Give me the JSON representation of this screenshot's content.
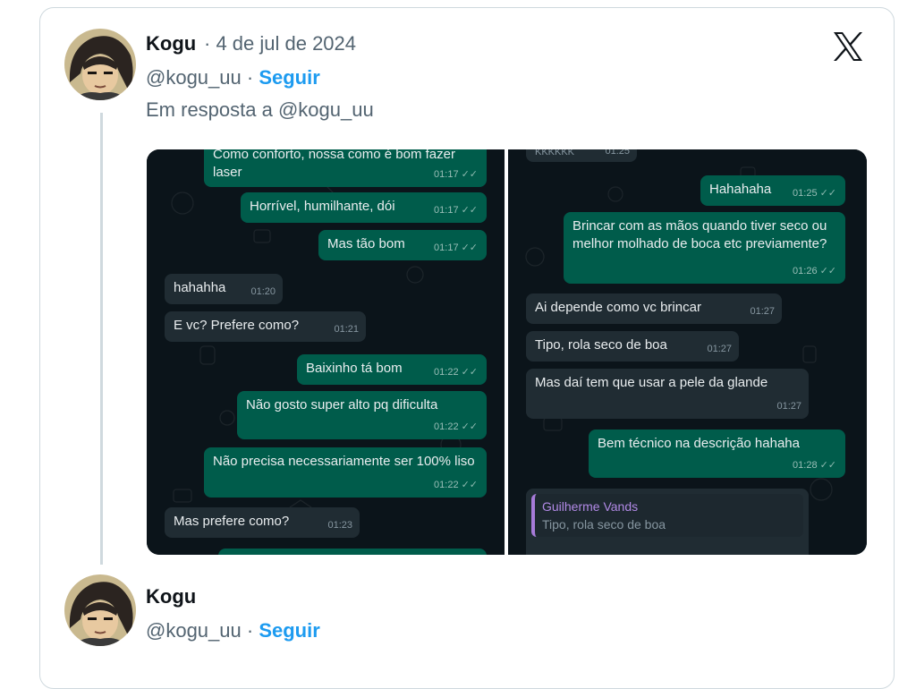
{
  "tweet1": {
    "author": "Kogu",
    "date": "· 4 de jul de 2024",
    "handle": "@kogu_uu ·",
    "follow": "Seguir",
    "reply_to": "Em resposta a @kogu_uu"
  },
  "tweet2": {
    "author": "Kogu",
    "handle": "@kogu_uu ·",
    "follow": "Seguir"
  },
  "logo": "x-logo-icon",
  "chat_left": [
    {
      "text": "Como conforto, nossa como é bom fazer laser",
      "time": "01:17",
      "dir": "out"
    },
    {
      "text": "Horrível, humilhante, dói",
      "time": "01:17",
      "dir": "out"
    },
    {
      "text": "Mas tão bom",
      "time": "01:17",
      "dir": "out"
    },
    {
      "text": "hahahha",
      "time": "01:20",
      "dir": "in"
    },
    {
      "text": "E vc? Prefere como?",
      "time": "01:21",
      "dir": "in"
    },
    {
      "text": "Baixinho tá bom",
      "time": "01:22",
      "dir": "out"
    },
    {
      "text": "Não gosto super alto pq dificulta",
      "time": "01:22",
      "dir": "out"
    },
    {
      "text": "Não precisa necessariamente ser 100% liso",
      "time": "01:22",
      "dir": "out"
    },
    {
      "text": "Mas prefere como?",
      "time": "01:23",
      "dir": "in"
    }
  ],
  "chat_right": [
    {
      "text": "KKKKKK",
      "time": "01:25",
      "dir": "in"
    },
    {
      "text": "Hahahaha",
      "time": "01:25",
      "dir": "out"
    },
    {
      "text": "Brincar com as mãos quando tiver seco ou melhor molhado de boca etc previamente?",
      "time": "01:26",
      "dir": "out"
    },
    {
      "text": "Ai depende como vc brincar",
      "time": "01:27",
      "dir": "in"
    },
    {
      "text": "Tipo, rola seco de boa",
      "time": "01:27",
      "dir": "in"
    },
    {
      "text": "Mas daí tem que usar a pele da glande",
      "time": "01:27",
      "dir": "in"
    },
    {
      "text": "Bem técnico na descrição hahaha",
      "time": "01:28",
      "dir": "out"
    }
  ],
  "quote": {
    "name": "Guilherme Vands",
    "text": "Tipo, rola seco de boa"
  },
  "colors": {
    "follow": "#1d9bf0",
    "outgoing_bubble": "#005c4b",
    "incoming_bubble": "#202c33",
    "chat_bg": "#0b141a"
  }
}
